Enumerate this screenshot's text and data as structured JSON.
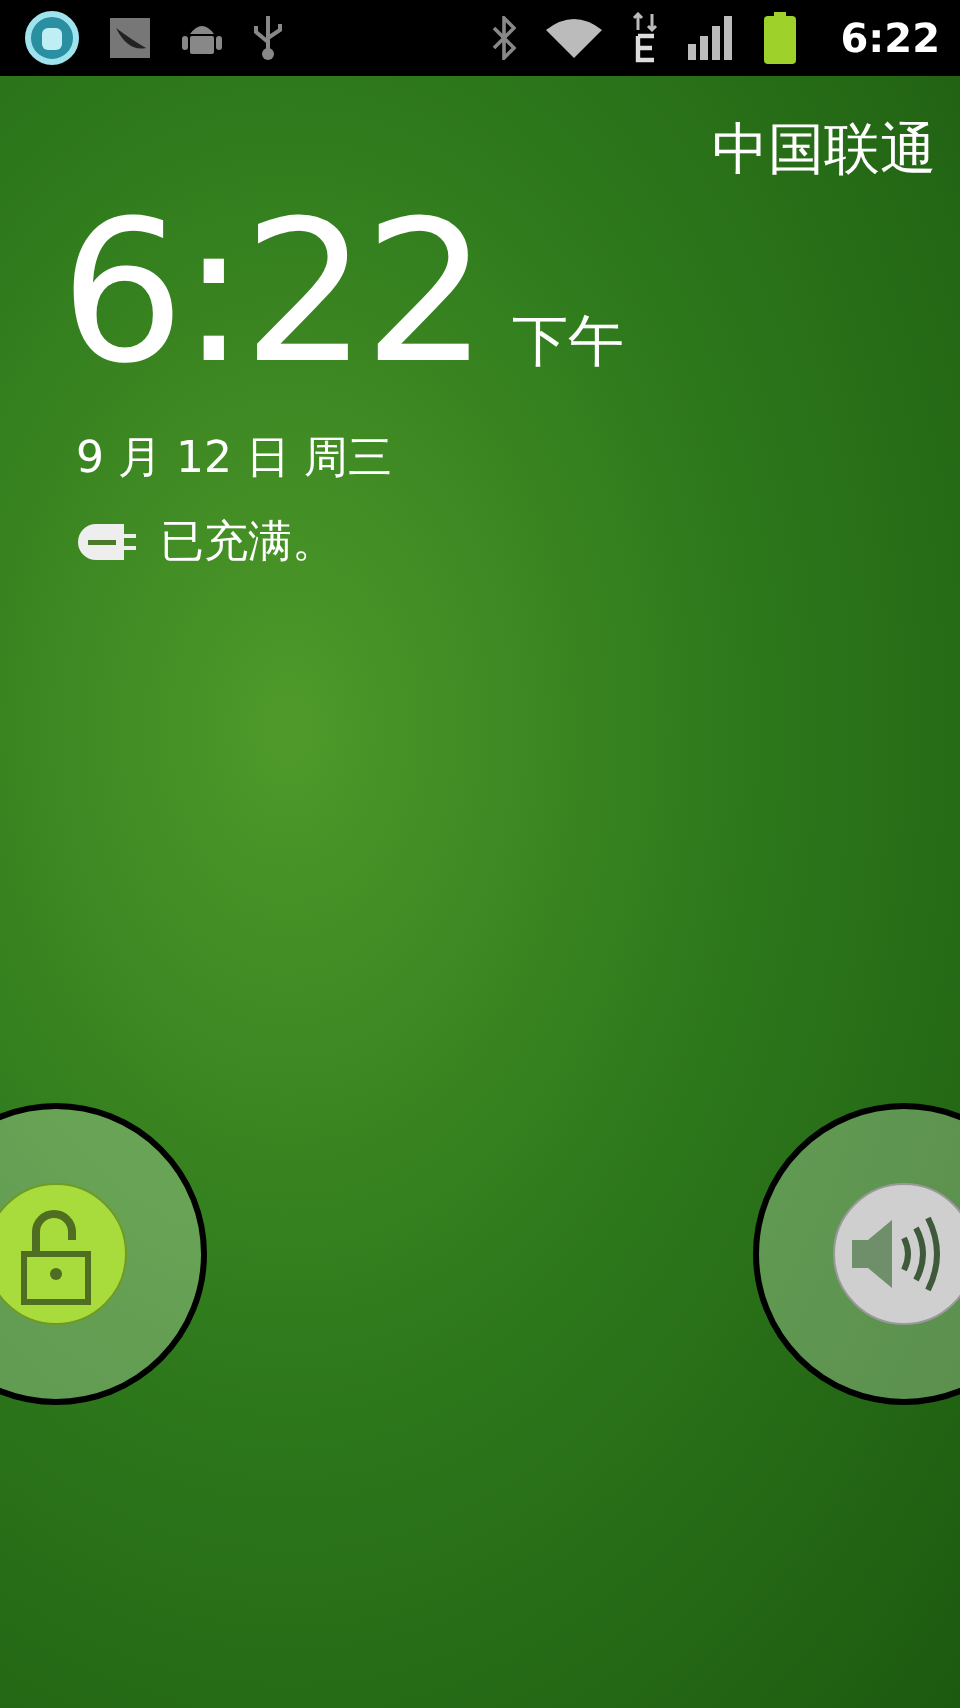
{
  "status_bar": {
    "time": "6:22"
  },
  "lock_screen": {
    "carrier": "中国联通",
    "clock": {
      "time": "6:22",
      "period": "下午"
    },
    "date": "9 月 12 日 周三",
    "charging_status": "已充满。"
  }
}
